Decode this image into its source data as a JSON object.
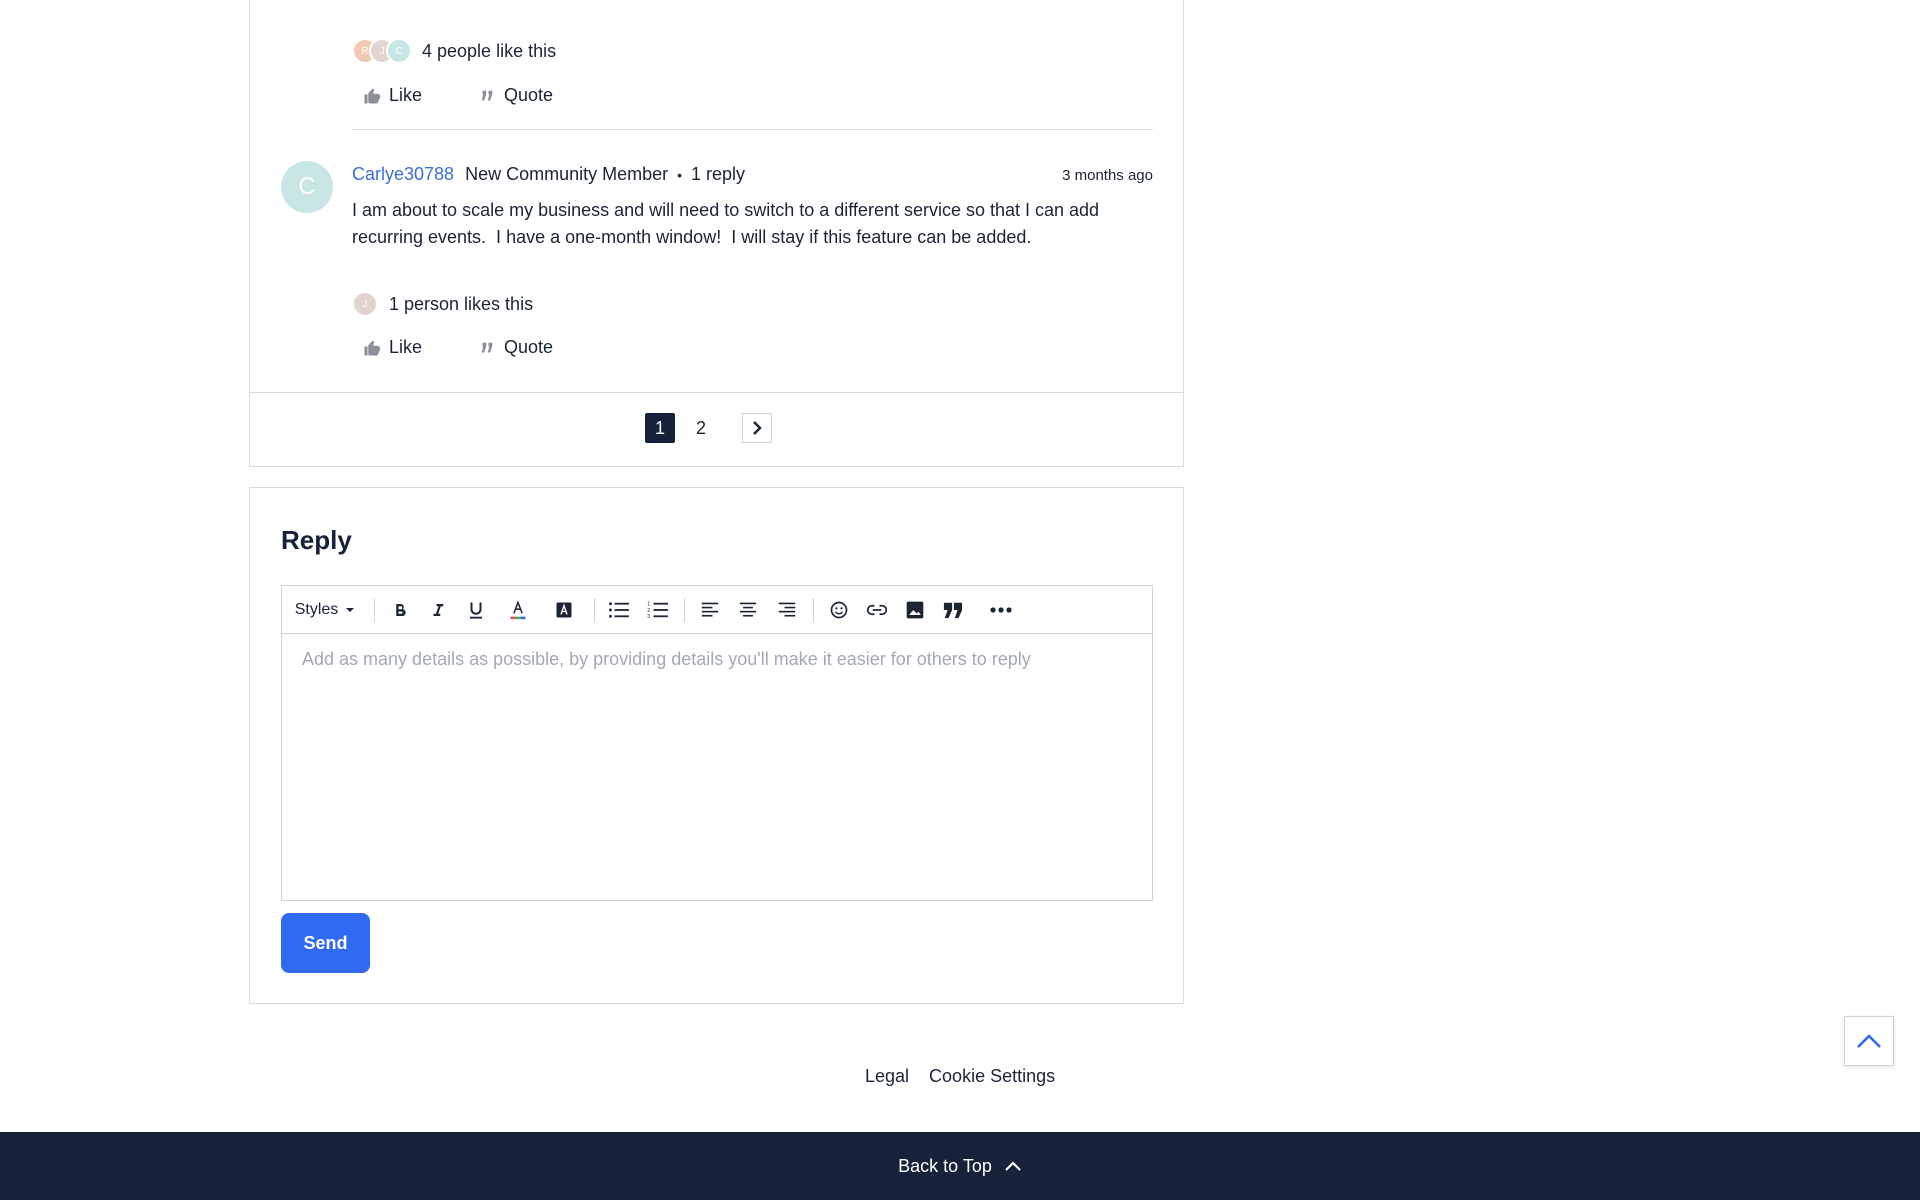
{
  "post_one": {
    "likers": [
      {
        "initial": "R",
        "color": "#f2c9b3"
      },
      {
        "initial": "J",
        "color": "#e3d4cf"
      },
      {
        "initial": "C",
        "color": "#c7e6e3"
      }
    ],
    "likes_text": "4 people like this",
    "like_label": "Like",
    "quote_label": "Quote"
  },
  "post_two": {
    "avatar_initial": "C",
    "author": "Carlye30788",
    "role": "New Community Member",
    "separator": "•",
    "reply_count": "1 reply",
    "timestamp": "3 months ago",
    "body": "I am about to scale my business and will need to switch to a different service so that I can add recurring events.  I have a one-month window!  I will stay if this feature can be added.",
    "likers": [
      {
        "initial": "J",
        "color": "#e3d4cf"
      }
    ],
    "likes_text": "1 person likes this",
    "like_label": "Like",
    "quote_label": "Quote"
  },
  "pagination": {
    "pages": [
      "1",
      "2"
    ],
    "current": "1"
  },
  "reply": {
    "title": "Reply",
    "toolbar": {
      "styles_label": "Styles"
    },
    "placeholder": "Add as many details as possible, by providing details you'll make it easier for others to reply",
    "send_label": "Send"
  },
  "footer": {
    "links": [
      "Legal",
      "Cookie Settings"
    ],
    "back_to_top": "Back to Top"
  },
  "colors": {
    "accent": "#2f6af0",
    "navy": "#16223a",
    "link": "#3b6fd8"
  }
}
